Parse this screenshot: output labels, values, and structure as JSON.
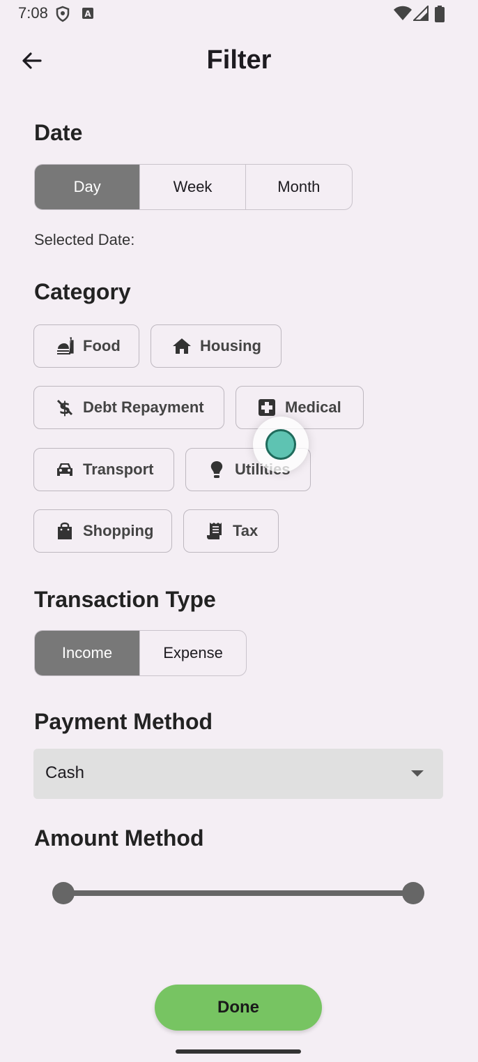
{
  "status_bar": {
    "time": "7:08"
  },
  "app_bar": {
    "title": "Filter"
  },
  "date": {
    "title": "Date",
    "options": [
      "Day",
      "Week",
      "Month"
    ],
    "selected": "Day",
    "selected_date_label": "Selected Date:"
  },
  "category": {
    "title": "Category",
    "chips": [
      {
        "label": "Food",
        "icon": "food-icon"
      },
      {
        "label": "Housing",
        "icon": "home-icon"
      },
      {
        "label": "Debt Repayment",
        "icon": "money-off-icon"
      },
      {
        "label": "Medical",
        "icon": "medical-icon"
      },
      {
        "label": "Transport",
        "icon": "car-icon"
      },
      {
        "label": "Utilities",
        "icon": "lightbulb-icon"
      },
      {
        "label": "Shopping",
        "icon": "shopping-bag-icon"
      },
      {
        "label": "Tax",
        "icon": "receipt-icon"
      }
    ]
  },
  "transaction_type": {
    "title": "Transaction Type",
    "options": [
      "Income",
      "Expense"
    ],
    "selected": "Income"
  },
  "payment_method": {
    "title": "Payment Method",
    "value": "Cash"
  },
  "amount": {
    "title": "Amount Method",
    "range_start_fraction": 0.0,
    "range_end_fraction": 1.0
  },
  "done_label": "Done",
  "colors": {
    "background": "#f4eef4",
    "selected_segment": "#787878",
    "done_button": "#77c462",
    "dropdown": "#e0e0e0"
  }
}
